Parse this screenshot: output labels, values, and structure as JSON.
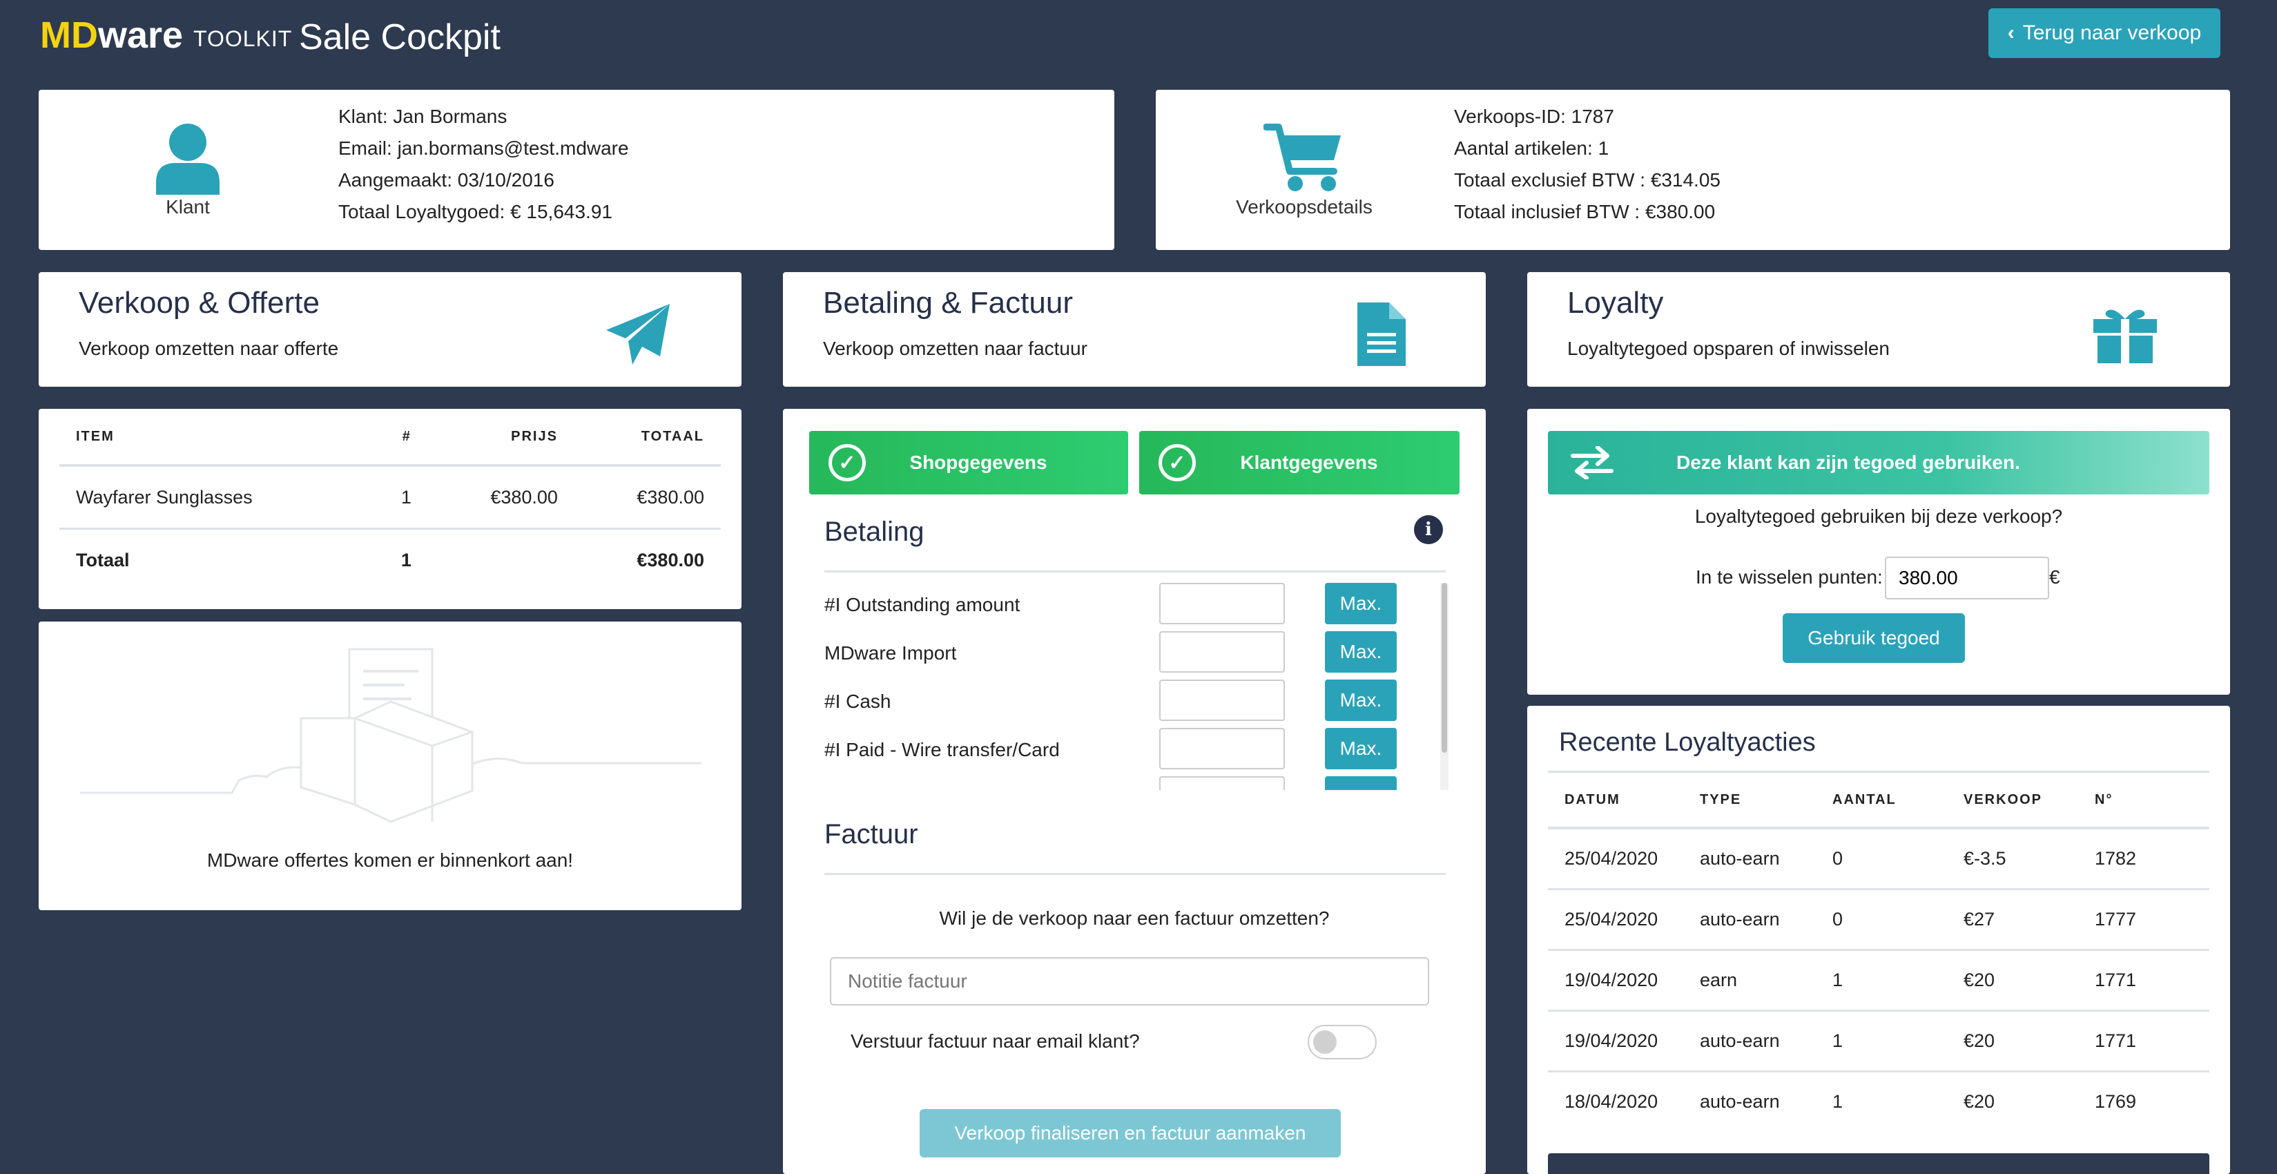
{
  "header": {
    "logo_md": "MD",
    "logo_ware": "ware",
    "logo_toolkit": "TOOLKIT",
    "title": "Sale Cockpit",
    "back_button": "Terug naar verkoop"
  },
  "customer": {
    "caption": "Klant",
    "rows": [
      {
        "label": "Klant:",
        "value": "Jan Bormans"
      },
      {
        "label": "Email:",
        "value": "jan.bormans@test.mdware"
      },
      {
        "label": "Aangemaakt:",
        "value": "03/10/2016"
      },
      {
        "label": "Totaal Loyaltygoed:",
        "value": "€ 15,643.91"
      }
    ]
  },
  "sale": {
    "caption": "Verkoopsdetails",
    "rows": [
      {
        "label": "Verkoops-ID:",
        "value": "1787"
      },
      {
        "label": "Aantal artikelen:",
        "value": "1"
      },
      {
        "label": "Totaal exclusief BTW :",
        "value": "€314.05"
      },
      {
        "label": "Totaal inclusief BTW :",
        "value": "€380.00"
      }
    ]
  },
  "sections": {
    "quote": {
      "title": "Verkoop & Offerte",
      "subtitle": "Verkoop omzetten naar offerte",
      "icon": "paper-plane-icon"
    },
    "invoice": {
      "title": "Betaling & Factuur",
      "subtitle": "Verkoop omzetten naar factuur",
      "icon": "document-icon"
    },
    "loyalty": {
      "title": "Loyalty",
      "subtitle": "Loyaltytegoed opsparen of inwisselen",
      "icon": "gift-icon"
    }
  },
  "items_table": {
    "headers": [
      "ITEM",
      "#",
      "PRIJS",
      "TOTAAL"
    ],
    "rows": [
      {
        "item": "Wayfarer Sunglasses",
        "qty": "1",
        "price": "€380.00",
        "total": "€380.00"
      }
    ],
    "total": {
      "label": "Totaal",
      "qty": "1",
      "total": "€380.00"
    }
  },
  "quotes_placeholder": "MDware offertes komen er binnenkort aan!",
  "payment": {
    "shop_button": "Shopgegevens",
    "customer_button": "Klantgegevens",
    "heading": "Betaling",
    "methods": [
      {
        "label": "#I Outstanding amount",
        "button": "Max."
      },
      {
        "label": "MDware Import",
        "button": "Max."
      },
      {
        "label": "#I Cash",
        "button": "Max."
      },
      {
        "label": "#I Paid - Wire transfer/Card",
        "button": "Max."
      }
    ],
    "invoice_heading": "Factuur",
    "invoice_question": "Wil je de verkoop naar een factuur omzetten?",
    "note_placeholder": "Notitie factuur",
    "email_toggle_label": "Verstuur factuur naar email klant?",
    "finalize_button": "Verkoop finaliseren en factuur aanmaken"
  },
  "loyalty": {
    "banner": "Deze klant kan zijn tegoed gebruiken.",
    "question": "Loyaltytegoed gebruiken bij deze verkoop?",
    "points_label": "In te wisselen punten:",
    "points_value": "380.00",
    "currency": "€",
    "use_button": "Gebruik tegoed"
  },
  "recent": {
    "title": "Recente Loyaltyacties",
    "headers": [
      "DATUM",
      "TYPE",
      "AANTAL",
      "VERKOOP",
      "N°"
    ],
    "rows": [
      [
        "25/04/2020",
        "auto-earn",
        "0",
        "€-3.5",
        "1782"
      ],
      [
        "25/04/2020",
        "auto-earn",
        "0",
        "€27",
        "1777"
      ],
      [
        "19/04/2020",
        "earn",
        "1",
        "€20",
        "1771"
      ],
      [
        "19/04/2020",
        "auto-earn",
        "1",
        "€20",
        "1771"
      ],
      [
        "18/04/2020",
        "auto-earn",
        "1",
        "€20",
        "1769"
      ]
    ]
  },
  "colors": {
    "background": "#2d3a4f",
    "accent": "#2aa3b9",
    "green": "#2ecc71",
    "logo_yellow": "#f5d30f"
  }
}
